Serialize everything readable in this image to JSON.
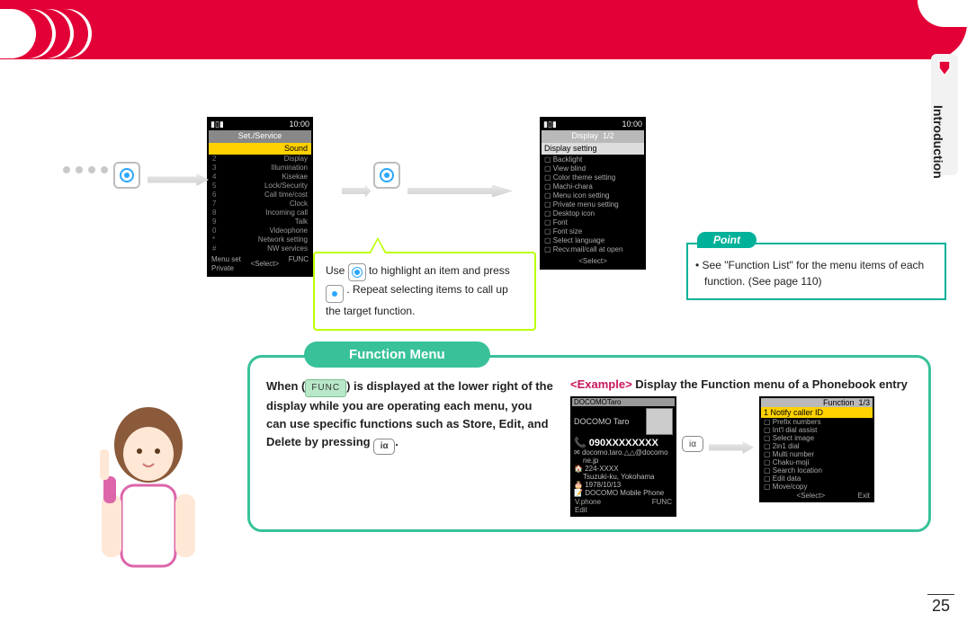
{
  "sideTab": {
    "label": "Introduction"
  },
  "row1": {
    "phoneA": {
      "time": "10:00",
      "title": "Set./Service",
      "highlight": "Sound",
      "items": [
        {
          "n": "2",
          "t": "Display"
        },
        {
          "n": "3",
          "t": "Illumination"
        },
        {
          "n": "4",
          "t": "Kisekae"
        },
        {
          "n": "5",
          "t": "Lock/Security"
        },
        {
          "n": "6",
          "t": "Call time/cost"
        },
        {
          "n": "7",
          "t": "Clock"
        },
        {
          "n": "8",
          "t": "Incoming call"
        },
        {
          "n": "9",
          "t": "Talk"
        },
        {
          "n": "0",
          "t": "Videophone"
        },
        {
          "n": "*",
          "t": "Network setting"
        },
        {
          "n": "#",
          "t": "NW services"
        }
      ],
      "skL": "Menu set",
      "skC": "Select",
      "skR": "FUNC",
      "skL2": "Private"
    },
    "callout": {
      "part1": "Use ",
      "part2": " to highlight an item and press ",
      "part3": ". Repeat selecting items to call up the target function."
    },
    "phoneB": {
      "time": "10:00",
      "title": "Display",
      "page": "1/2",
      "section": "Display setting",
      "items": [
        "Backlight",
        "View blind",
        "Color theme setting",
        "Machi-chara",
        "Menu icon setting",
        "Private menu setting",
        "Desktop icon",
        "Font",
        "Font size",
        "Select language",
        "Recv.mail/call at open"
      ],
      "skC": "Select"
    },
    "pointBox": {
      "tab": "Point",
      "text": "See \"Function List\" for the menu items of each function. (See page 110)"
    }
  },
  "funcBox": {
    "tab": "Function Menu",
    "left": {
      "pre": "When (",
      "chip": "FUNC",
      "post": ") is displayed at the lower right of the display while you are operating each menu, you can use specific functions such as Store, Edit, and Delete by pressing ",
      "btn": "iα",
      "end": "."
    },
    "right": {
      "tag": "<Example>",
      "text": " Display the Function menu of a Phonebook entry",
      "btn": "iα",
      "entry": {
        "carrier": "DOCOMOTaro",
        "name": "DOCOMO Taro",
        "number": "090XXXXXXXX",
        "mail": "docomo.taro.△△@docomo",
        "mail2": "ne.jp",
        "addr": "224-XXXX",
        "addr2": "Tsuzuki-ku, Yokohama",
        "date": "1978/10/13",
        "misc": "DOCOMO Mobile Phone",
        "skL": "V.phone",
        "skL2": "Edit",
        "skR": "FUNC"
      },
      "fmenu": {
        "title": "Function",
        "page": "1/3",
        "hl": "Notify caller ID",
        "items": [
          "Prefix numbers",
          "Int'l dial assist",
          "Select image",
          "2in1 dial",
          "Multi number",
          "Chaku-moji",
          "Search location",
          "Edit data",
          "Move/copy"
        ],
        "skC": "Select",
        "skR": "Exit"
      }
    }
  },
  "pageNumber": "25"
}
